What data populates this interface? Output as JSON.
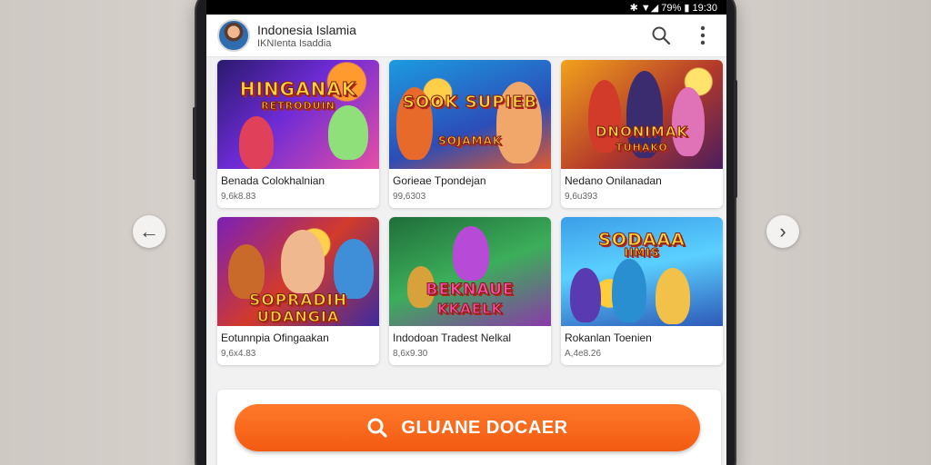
{
  "status_bar": {
    "indicators": "✱ ▼◢ 79% ▮ 19:30"
  },
  "app_bar": {
    "title": "Indonesia Islamia",
    "subtitle": "IKNIenta Isaddia",
    "search_icon": "search-icon",
    "more_icon": "more-vertical-icon"
  },
  "nav": {
    "prev": "←",
    "next": "›"
  },
  "cards": [
    {
      "title": "Benada Colokhalnian",
      "meta": "9,6k8.83",
      "banner": "HINGANAK",
      "banner_sub": "RETRODUIN",
      "palette": "g1"
    },
    {
      "title": "Gorieae Tpondejan",
      "meta": "99,6303",
      "banner": "SOOK SUPIEB",
      "banner_sub": "SOJAMAK",
      "palette": "g2"
    },
    {
      "title": "Nedano Onilanadan",
      "meta": "9,6u393",
      "banner": "DNONIMAK",
      "banner_sub": "TUHAKO",
      "palette": "g3"
    },
    {
      "title": "Eotunnpia Ofingaakan",
      "meta": "9,6x4.83",
      "banner": "SOPRADIH",
      "banner_sub": "UDANGIA",
      "palette": "g4"
    },
    {
      "title": "Indodoan Tradest Nelkal",
      "meta": "8,6x9.30",
      "banner": "BEKNAUE",
      "banner_sub": "KKAELK",
      "palette": "g5"
    },
    {
      "title": "Rokanlan Toenien",
      "meta": "A,4e8.26",
      "banner": "SODAAA",
      "banner_sub": "IIMIS",
      "palette": "g6"
    }
  ],
  "cta": {
    "label": "GLUANE DOCAER",
    "icon": "search-icon"
  },
  "colors": {
    "accent": "#f25a12",
    "screen_bg": "#f1f1f2"
  }
}
